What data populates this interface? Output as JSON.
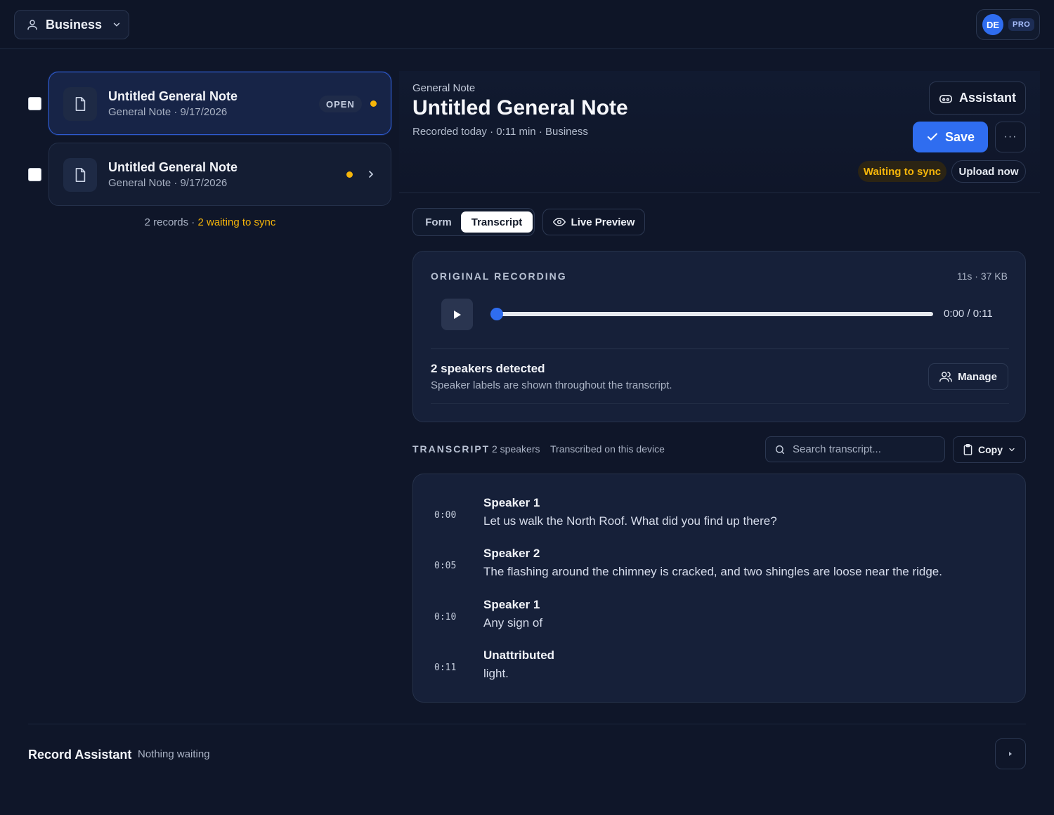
{
  "topbar": {
    "workspace_label": "Business",
    "user_initials": "DE",
    "plan_badge": "PRO"
  },
  "records": {
    "items": [
      {
        "title": "Untitled General Note",
        "subtitle": "General Note · 9/17/2026",
        "badge": "OPEN",
        "active": true
      },
      {
        "title": "Untitled General Note",
        "subtitle": "General Note · 9/17/2026",
        "active": false
      }
    ],
    "footer_count": "2 records",
    "footer_sep": " · ",
    "footer_waiting": "2 waiting to sync"
  },
  "detail": {
    "kind": "General Note",
    "title": "Untitled General Note",
    "meta": "Recorded today · 0:11 min · Business",
    "assistant_label": "Assistant",
    "save_label": "Save",
    "more_label": "···",
    "sync_status": "Waiting to sync",
    "upload_label": "Upload now"
  },
  "tabs": {
    "form": "Form",
    "transcript": "Transcript",
    "live_preview": "Live Preview"
  },
  "recording": {
    "label": "ORIGINAL RECORDING",
    "size": "11s · 37 KB",
    "time_readout": "0:00 / 0:11",
    "progress": 0,
    "speakers_title": "2 speakers detected",
    "speakers_sub": "Speaker labels are shown throughout the transcript.",
    "manage_label": "Manage"
  },
  "transcript": {
    "label": "TRANSCRIPT",
    "speaker_count": "2 speakers",
    "source": "Transcribed on this device",
    "search_placeholder": "Search transcript...",
    "copy_label": "Copy",
    "segments": [
      {
        "time": "0:00",
        "speaker": "Speaker 1",
        "text": "Let us walk the North Roof. What did you find up there?"
      },
      {
        "time": "0:05",
        "speaker": "Speaker 2",
        "text": "The flashing around the chimney is cracked, and two shingles are loose near the ridge."
      },
      {
        "time": "0:10",
        "speaker": "Speaker 1",
        "text": "Any sign of"
      },
      {
        "time": "0:11",
        "speaker": "Unattributed",
        "text": "light."
      }
    ]
  },
  "bottom": {
    "title": "Record Assistant",
    "status": "Nothing waiting"
  },
  "colors": {
    "accent": "#2f6df0",
    "warning": "#f5b50a",
    "background": "#0f1629"
  }
}
